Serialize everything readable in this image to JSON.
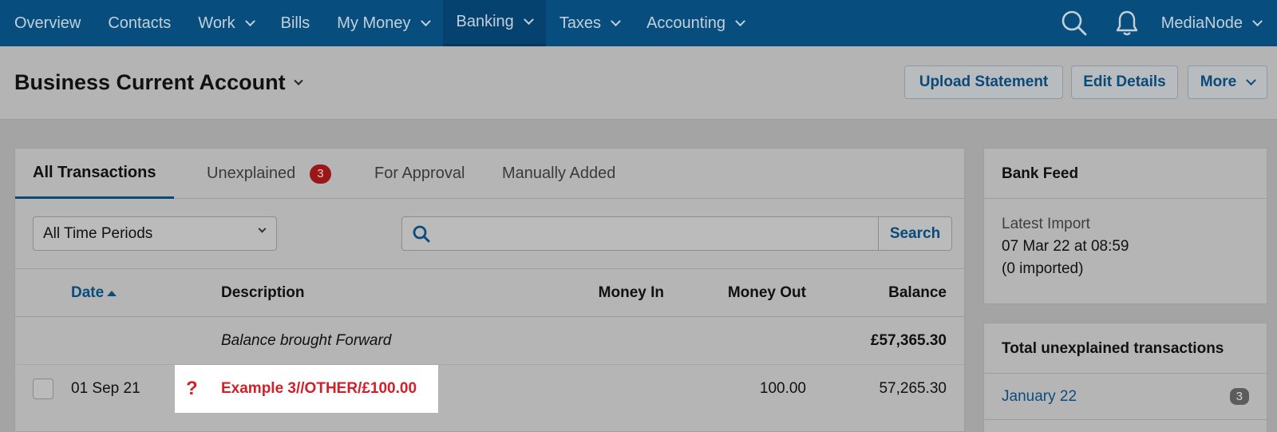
{
  "nav": {
    "items": [
      {
        "label": "Overview",
        "dropdown": false,
        "active": false
      },
      {
        "label": "Contacts",
        "dropdown": false,
        "active": false
      },
      {
        "label": "Work",
        "dropdown": true,
        "active": false
      },
      {
        "label": "Bills",
        "dropdown": false,
        "active": false
      },
      {
        "label": "My Money",
        "dropdown": true,
        "active": false
      },
      {
        "label": "Banking",
        "dropdown": true,
        "active": true
      },
      {
        "label": "Taxes",
        "dropdown": true,
        "active": false
      },
      {
        "label": "Accounting",
        "dropdown": true,
        "active": false
      }
    ],
    "user": "MediaNode"
  },
  "header": {
    "account_title": "Business Current Account",
    "upload_label": "Upload Statement",
    "edit_label": "Edit Details",
    "more_label": "More"
  },
  "tabs": {
    "all": "All Transactions",
    "unexplained": "Unexplained",
    "unexplained_count": "3",
    "approval": "For Approval",
    "manual": "Manually Added"
  },
  "filters": {
    "period": "All Time Periods",
    "search_placeholder": "",
    "search_button": "Search"
  },
  "table": {
    "columns": {
      "date": "Date",
      "description": "Description",
      "money_in": "Money In",
      "money_out": "Money Out",
      "balance": "Balance"
    },
    "brought_forward": {
      "description": "Balance brought Forward",
      "balance": "£57,365.30"
    },
    "rows": [
      {
        "date": "01 Sep 21",
        "status_mark": "?",
        "description": "Example 3//OTHER/£100.00",
        "money_in": "",
        "money_out": "100.00",
        "balance": "57,265.30"
      }
    ]
  },
  "bank_feed": {
    "title": "Bank Feed",
    "latest_label": "Latest Import",
    "latest_value": "07 Mar 22 at 08:59",
    "imported_note": "(0 imported)"
  },
  "unexplained_card": {
    "title": "Total unexplained transactions",
    "months": [
      {
        "label": "January 22",
        "count": "3"
      }
    ]
  },
  "colors": {
    "nav_bg": "#074e7e",
    "accent": "#094a79",
    "alert_red": "#d0202a"
  }
}
